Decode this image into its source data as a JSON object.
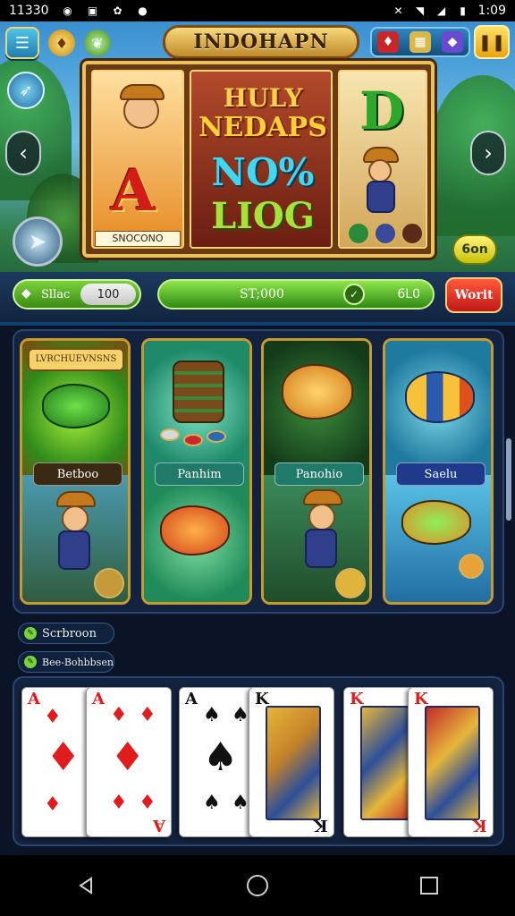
{
  "status_bar": {
    "time": "11330",
    "right_time": "1:09"
  },
  "header": {
    "title": "INDOHAPN"
  },
  "reel": {
    "banner_lines": [
      "HULY",
      "NEDAPS",
      "NO%",
      "LIOG"
    ],
    "left_letter": "A",
    "left_caption": "SNOCONO",
    "right_letter": "D"
  },
  "spin_button": {
    "label": "6on"
  },
  "balance": {
    "label": "Sllac",
    "value": "100"
  },
  "win_bar": {
    "amount": "ST;000",
    "right_value": "6L0"
  },
  "more_button": {
    "label": "Worit"
  },
  "games": {
    "banner_text": "LVRCHUEVNSNS",
    "tiles": [
      {
        "label": "Betboo",
        "label_color": "#3a2a14"
      },
      {
        "label": "Panhim",
        "label_color": "#1f7a6a"
      },
      {
        "label": "Panohio",
        "label_color": "#1f7a6a"
      },
      {
        "label": "Saelu",
        "label_color": "#1f3a8a"
      }
    ]
  },
  "tags": [
    {
      "label": "Scrbroon"
    },
    {
      "label": "Bee-Bohbbsen"
    }
  ],
  "cards": [
    {
      "rank": "A",
      "suit": "♦",
      "color": "red"
    },
    {
      "rank": "A",
      "suit": "♦",
      "color": "red"
    },
    {
      "rank": "A",
      "suit": "♠",
      "color": "black"
    },
    {
      "rank": "K",
      "suit": "♠",
      "color": "black"
    },
    {
      "rank": "K",
      "suit": "♥",
      "color": "red"
    },
    {
      "rank": "K",
      "suit": "♥",
      "color": "red"
    }
  ],
  "colors": {
    "accent_gold": "#e8c25a",
    "win_green": "#4fb22a",
    "more_red": "#c11818",
    "panel_bg": "#13233f"
  }
}
